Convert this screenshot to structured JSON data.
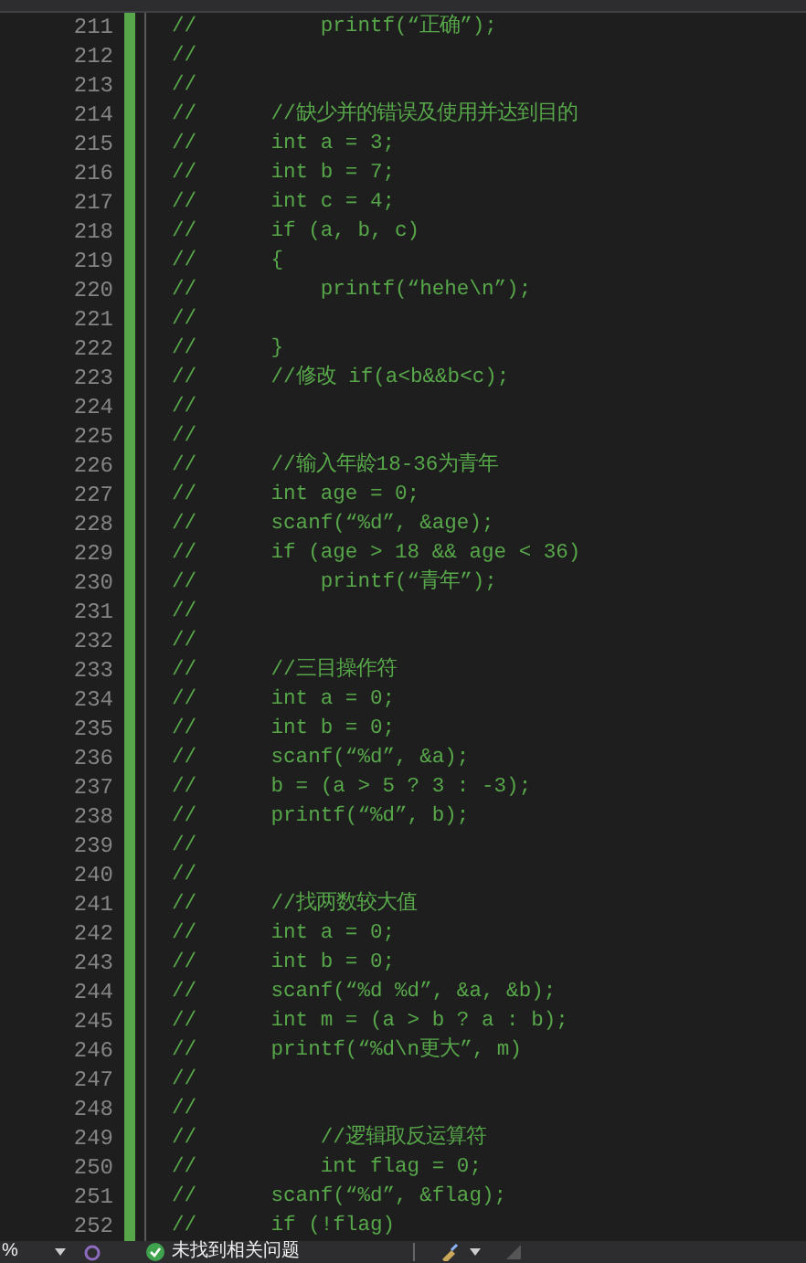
{
  "editor": {
    "lines": [
      {
        "number": "211",
        "text": "//          printf(“正确”);"
      },
      {
        "number": "212",
        "text": "//"
      },
      {
        "number": "213",
        "text": "//"
      },
      {
        "number": "214",
        "text": "//      //缺少并的错误及使用并达到目的"
      },
      {
        "number": "215",
        "text": "//      int a = 3;"
      },
      {
        "number": "216",
        "text": "//      int b = 7;"
      },
      {
        "number": "217",
        "text": "//      int c = 4;"
      },
      {
        "number": "218",
        "text": "//      if (a, b, c)"
      },
      {
        "number": "219",
        "text": "//      {"
      },
      {
        "number": "220",
        "text": "//          printf(“hehe\\n”);"
      },
      {
        "number": "221",
        "text": "//"
      },
      {
        "number": "222",
        "text": "//      }"
      },
      {
        "number": "223",
        "text": "//      //修改 if(a<b&&b<c);"
      },
      {
        "number": "224",
        "text": "//"
      },
      {
        "number": "225",
        "text": "//"
      },
      {
        "number": "226",
        "text": "//      //输入年龄18-36为青年"
      },
      {
        "number": "227",
        "text": "//      int age = 0;"
      },
      {
        "number": "228",
        "text": "//      scanf(“%d”, &age);"
      },
      {
        "number": "229",
        "text": "//      if (age > 18 && age < 36)"
      },
      {
        "number": "230",
        "text": "//          printf(“青年”);"
      },
      {
        "number": "231",
        "text": "//"
      },
      {
        "number": "232",
        "text": "//"
      },
      {
        "number": "233",
        "text": "//      //三目操作符"
      },
      {
        "number": "234",
        "text": "//      int a = 0;"
      },
      {
        "number": "235",
        "text": "//      int b = 0;"
      },
      {
        "number": "236",
        "text": "//      scanf(“%d”, &a);"
      },
      {
        "number": "237",
        "text": "//      b = (a > 5 ? 3 : -3);"
      },
      {
        "number": "238",
        "text": "//      printf(“%d”, b);"
      },
      {
        "number": "239",
        "text": "//"
      },
      {
        "number": "240",
        "text": "//"
      },
      {
        "number": "241",
        "text": "//      //找两数较大值"
      },
      {
        "number": "242",
        "text": "//      int a = 0;"
      },
      {
        "number": "243",
        "text": "//      int b = 0;"
      },
      {
        "number": "244",
        "text": "//      scanf(“%d %d”, &a, &b);"
      },
      {
        "number": "245",
        "text": "//      int m = (a > b ? a : b);"
      },
      {
        "number": "246",
        "text": "//      printf(“%d\\n更大”, m)"
      },
      {
        "number": "247",
        "text": "//"
      },
      {
        "number": "248",
        "text": "//"
      },
      {
        "number": "249",
        "text": "//          //逻辑取反运算符"
      },
      {
        "number": "250",
        "text": "//          int flag = 0;"
      },
      {
        "number": "251",
        "text": "//      scanf(“%d”, &flag);"
      },
      {
        "number": "252",
        "text": "//      if (!flag)"
      }
    ]
  },
  "status_bar": {
    "zoom": "%",
    "issues": "未找到相关问题"
  }
}
